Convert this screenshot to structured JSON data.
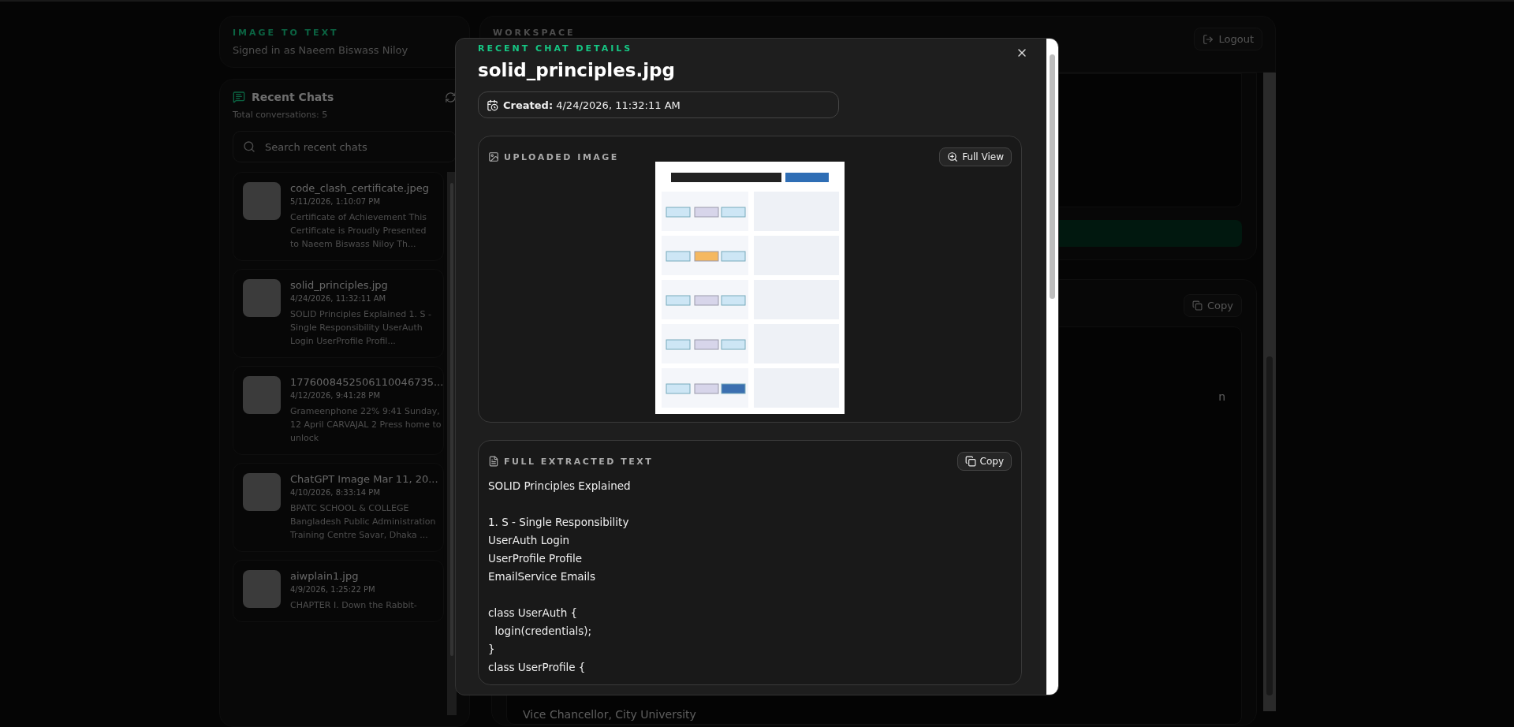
{
  "sidebar": {
    "app_label": "IMAGE TO TEXT",
    "signed_in": "Signed in as Naeem Biswass Niloy",
    "recent_title": "Recent Chats",
    "total": "Total conversations: 5",
    "search": {
      "placeholder": "Search recent chats"
    },
    "chats": [
      {
        "title": "code_clash_certificate.jpeg",
        "date": "5/11/2026, 1:10:07 PM",
        "preview": "Certificate of Achievement This Certificate is Proudly Presented to Naeem Biswass Niloy Th..."
      },
      {
        "title": "solid_principles.jpg",
        "date": "4/24/2026, 11:32:11 AM",
        "preview": "SOLID Principles Explained 1. S - Single Responsibility UserAuth Login UserProfile Profil..."
      },
      {
        "title": "1776008452506110046735...",
        "date": "4/12/2026, 9:41:28 PM",
        "preview": "Grameenphone 22% 9:41 Sunday, 12 April CARVAJAL 2 Press home to unlock"
      },
      {
        "title": "ChatGPT Image Mar 11, 20...",
        "date": "4/10/2026, 8:33:14 PM",
        "preview": "BPATC SCHOOL & COLLEGE Bangladesh Public Administration Training Centre Savar, Dhaka ..."
      },
      {
        "title": "aiwplain1.jpg",
        "date": "4/9/2026, 1:25:22 PM",
        "preview": "CHAPTER I. Down the Rabbit-"
      }
    ]
  },
  "workspace": {
    "label": "WORKSPACE",
    "logout": "Logout",
    "copy": "Copy",
    "fragment": "n",
    "footer_line": "Vice Chancellor, City University"
  },
  "modal": {
    "eyebrow": "RECENT CHAT DETAILS",
    "title": "solid_principles.jpg",
    "created_label": "Created:",
    "created_value": "4/24/2026, 11:32:11 AM",
    "uploaded_heading": "UPLOADED IMAGE",
    "full_view": "Full View",
    "extracted_heading": "FULL EXTRACTED TEXT",
    "copy": "Copy",
    "extracted_text": "SOLID Principles Explained\n\n1. S - Single Responsibility\nUserAuth Login\nUserProfile Profile\nEmailService Emails\n\nclass UserAuth {\n  login(credentials);\n}\nclass UserProfile {"
  }
}
